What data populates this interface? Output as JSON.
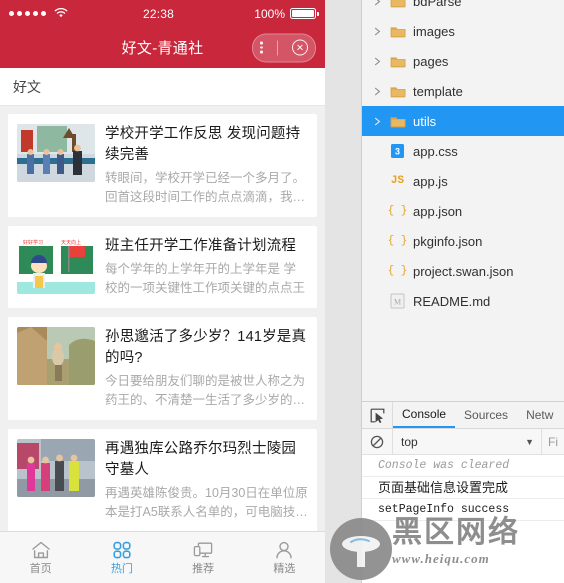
{
  "phone": {
    "status_bar": {
      "signal_dots": 5,
      "wifi_icon": "wifi-icon",
      "time": "22:38",
      "battery_percent": "100%",
      "battery_level": 100
    },
    "nav": {
      "title": "好文-青通社",
      "menu_icon": "more-dots-icon",
      "close_icon": "close-circle-icon"
    },
    "category_bar": {
      "label": "好文"
    },
    "articles": [
      {
        "title": "学校开学工作反思 发现问题持续完善",
        "desc": "转眼间，学校开学已经一个多月了。回首这段时间工作的点点滴滴，我心里有很多感...",
        "thumb": "school-opening-photo"
      },
      {
        "title": "班主任开学工作准备计划流程",
        "desc": "每个学年的上学年开的上学年是 学校的一项关键性工作项关键的点点王",
        "thumb": "classroom-cartoon-photo"
      },
      {
        "title": "孙思邈活了多少岁？141岁是真的吗?",
        "desc": "今日要给朋友们聊的是被世人称之为药王的、不清楚一生活了多少岁的孙思邈。有...",
        "thumb": "mountain-sage-photo"
      },
      {
        "title": "再遇独库公路乔尔玛烈士陵园守墓人",
        "desc": "再遇英雄陈俊贵。10月30日在单位原本是打A5联系人名单的，可电脑技术水平一般",
        "thumb": "group-people-photo"
      }
    ],
    "tabbar": [
      {
        "label": "首页",
        "icon": "home-icon",
        "active": false
      },
      {
        "label": "热门",
        "icon": "grid-icon",
        "active": true
      },
      {
        "label": "推荐",
        "icon": "devices-icon",
        "active": false
      },
      {
        "label": "精选",
        "icon": "user-icon",
        "active": false
      }
    ],
    "colors": {
      "brand": "#c8273c",
      "active_tab": "#3a9fe0"
    }
  },
  "file_tree": {
    "items": [
      {
        "label": "bdParse",
        "type": "folder",
        "icon": "folder-icon",
        "expandable": true,
        "selected": false
      },
      {
        "label": "images",
        "type": "folder",
        "icon": "folder-icon",
        "expandable": true,
        "selected": false
      },
      {
        "label": "pages",
        "type": "folder",
        "icon": "folder-icon",
        "expandable": true,
        "selected": false
      },
      {
        "label": "template",
        "type": "folder",
        "icon": "folder-icon",
        "expandable": true,
        "selected": false
      },
      {
        "label": "utils",
        "type": "folder",
        "icon": "folder-icon",
        "expandable": true,
        "selected": true
      },
      {
        "label": "app.css",
        "type": "css",
        "icon": "css-file-icon",
        "expandable": false,
        "selected": false
      },
      {
        "label": "app.js",
        "type": "js",
        "icon": "js-file-icon",
        "expandable": false,
        "selected": false
      },
      {
        "label": "app.json",
        "type": "json",
        "icon": "json-file-icon",
        "expandable": false,
        "selected": false
      },
      {
        "label": "pkginfo.json",
        "type": "json",
        "icon": "json-file-icon",
        "expandable": false,
        "selected": false
      },
      {
        "label": "project.swan.json",
        "type": "json",
        "icon": "json-file-icon",
        "expandable": false,
        "selected": false
      },
      {
        "label": "README.md",
        "type": "markdown",
        "icon": "markdown-file-icon",
        "expandable": false,
        "selected": false
      }
    ],
    "selection_color": "#2196f3"
  },
  "devtools": {
    "inspect_icon": "inspect-element-icon",
    "tabs": [
      {
        "label": "Console",
        "active": true
      },
      {
        "label": "Sources",
        "active": false
      },
      {
        "label": "Netw",
        "active": false
      }
    ],
    "toolbar": {
      "clear_icon": "clear-console-icon",
      "context": "top",
      "caret_icon": "chevron-down-icon",
      "filter_placeholder": "Fi"
    },
    "log": [
      {
        "text": "Console was cleared",
        "style": "muted"
      },
      {
        "text": "页面基础信息设置完成",
        "style": "cn"
      },
      {
        "text": "setPageInfo success",
        "style": "plain"
      }
    ]
  },
  "watermark": {
    "cn_text": "黑区网络",
    "url_text": "www.heiqu.com",
    "logo_icon": "mushroom-logo-icon"
  }
}
